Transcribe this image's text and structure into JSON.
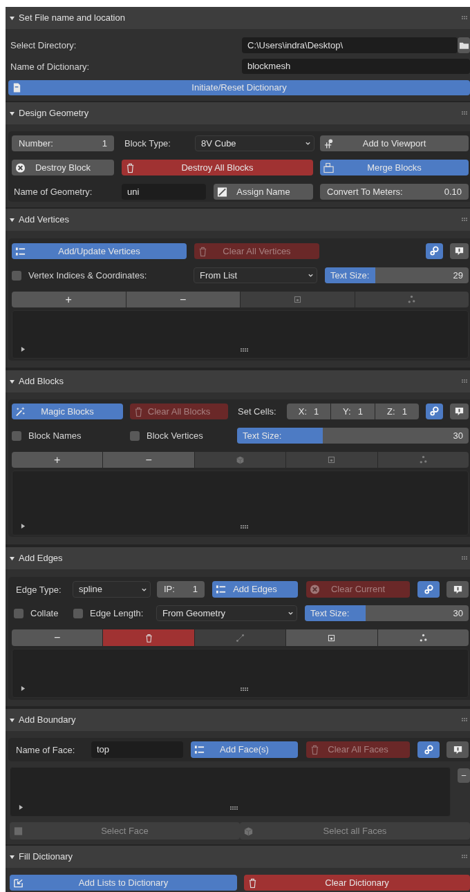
{
  "panels": [
    {
      "title": "Set File name and location",
      "expanded": true,
      "rows": [
        {
          "controls": [
            {
              "kind": "label",
              "text": "Select Directory:"
            },
            {
              "kind": "field",
              "value": "C:\\Users\\indra\\Desktop\\"
            },
            {
              "kind": "icon_button",
              "color": "#575757"
            }
          ]
        },
        {
          "controls": [
            {
              "kind": "label",
              "text": "Name of Dictionary:"
            },
            {
              "kind": "field",
              "value": "blockmesh"
            }
          ]
        },
        {
          "controls": [
            {
              "kind": "button",
              "label": "Initiate/Reset Dictionary",
              "color": "#4d7bc4",
              "disabled": false
            }
          ]
        }
      ]
    },
    {
      "title": "Design Geometry",
      "expanded": true,
      "rows": [
        {
          "controls": [
            {
              "kind": "number",
              "label": "Number:",
              "value": "1"
            },
            {
              "kind": "label",
              "text": "Block Type:"
            },
            {
              "kind": "dropdown",
              "value": "8V Cube"
            },
            {
              "kind": "button",
              "label": "Add to Viewport",
              "color": "#575757",
              "disabled": false
            }
          ]
        },
        {
          "controls": [
            {
              "kind": "button",
              "label": "Destroy Block",
              "color": "#575757",
              "disabled": false
            },
            {
              "kind": "button",
              "label": "Destroy All Blocks",
              "color": "#a03232",
              "disabled": false
            },
            {
              "kind": "button",
              "label": "Merge Blocks",
              "color": "#4d7bc4",
              "disabled": false
            }
          ]
        },
        {
          "controls": [
            {
              "kind": "label",
              "text": "Name of Geometry:"
            },
            {
              "kind": "field",
              "value": "uni"
            },
            {
              "kind": "button",
              "label": "Assign Name",
              "color": "#575757",
              "disabled": false
            },
            {
              "kind": "number",
              "label": "Convert To Meters:",
              "value": "0.10"
            }
          ]
        }
      ]
    },
    {
      "title": "Add Vertices",
      "expanded": true,
      "rows": [
        {
          "controls": [
            {
              "kind": "button",
              "label": "Add/Update Vertices",
              "color": "#4d7bc4",
              "disabled": false
            },
            {
              "kind": "button",
              "label": "Clear All Vertices",
              "color": "#6a2828",
              "disabled": true
            },
            {
              "kind": "icon_button",
              "color": "#4d7bc4"
            },
            {
              "kind": "icon_button",
              "color": "#575757"
            }
          ]
        },
        {
          "controls": [
            {
              "kind": "checkbox",
              "label": "Vertex Indices & Coordinates:",
              "checked": false
            },
            {
              "kind": "dropdown",
              "value": "From List"
            },
            {
              "kind": "slider",
              "label": "Text Size:",
              "value": "29",
              "level": 0.35
            }
          ]
        },
        {
          "controls": [
            {
              "kind": "toolbar",
              "segments": [
                {
                  "label": "+",
                  "color": "#575757",
                  "disabled": false
                },
                {
                  "label": "−",
                  "color": "#575757",
                  "disabled": false
                },
                {
                  "color": "#3e3e3e",
                  "disabled": true
                },
                {
                  "color": "#3e3e3e",
                  "disabled": true
                }
              ]
            }
          ]
        },
        {
          "controls": [
            {
              "kind": "list"
            }
          ]
        }
      ]
    },
    {
      "title": "Add Blocks",
      "expanded": true,
      "rows": [
        {
          "controls": [
            {
              "kind": "button",
              "label": "Magic Blocks",
              "color": "#4d7bc4",
              "disabled": false
            },
            {
              "kind": "button",
              "label": "Clear All Blocks",
              "color": "#6a2828",
              "disabled": true
            },
            {
              "kind": "label",
              "text": "Set Cells:"
            },
            {
              "kind": "number_group",
              "items": [
                {
                  "label": "X:",
                  "value": "1"
                },
                {
                  "label": "Y:",
                  "value": "1"
                },
                {
                  "label": "Z:",
                  "value": "1"
                }
              ]
            },
            {
              "kind": "icon_button",
              "color": "#4d7bc4"
            },
            {
              "kind": "icon_button",
              "color": "#575757"
            }
          ]
        },
        {
          "controls": [
            {
              "kind": "checkbox",
              "label": "Block Names",
              "checked": false
            },
            {
              "kind": "checkbox",
              "label": "Block Vertices",
              "checked": false
            },
            {
              "kind": "slider",
              "label": "Text Size:",
              "value": "30",
              "level": 0.37
            }
          ]
        },
        {
          "controls": [
            {
              "kind": "toolbar",
              "segments": [
                {
                  "label": "+",
                  "color": "#575757",
                  "disabled": false
                },
                {
                  "label": "−",
                  "color": "#575757",
                  "disabled": false
                },
                {
                  "color": "#3e3e3e",
                  "disabled": true
                },
                {
                  "color": "#3e3e3e",
                  "disabled": true
                },
                {
                  "color": "#3e3e3e",
                  "disabled": true
                }
              ]
            }
          ]
        },
        {
          "controls": [
            {
              "kind": "list"
            }
          ]
        }
      ]
    },
    {
      "title": "Add Edges",
      "expanded": true,
      "rows": [
        {
          "controls": [
            {
              "kind": "label",
              "text": "Edge Type:"
            },
            {
              "kind": "dropdown",
              "value": "spline"
            },
            {
              "kind": "number",
              "label": "IP:",
              "value": "1"
            },
            {
              "kind": "button",
              "label": "Add Edges",
              "color": "#4d7bc4",
              "disabled": false
            },
            {
              "kind": "button",
              "label": "Clear Current",
              "color": "#6a2828",
              "disabled": true
            },
            {
              "kind": "icon_button",
              "color": "#4d7bc4"
            },
            {
              "kind": "icon_button",
              "color": "#575757"
            }
          ]
        },
        {
          "controls": [
            {
              "kind": "checkbox",
              "label": "Collate",
              "checked": false
            },
            {
              "kind": "checkbox",
              "label": "Edge Length:",
              "checked": false
            },
            {
              "kind": "dropdown",
              "value": "From Geometry"
            },
            {
              "kind": "slider",
              "label": "Text Size:",
              "value": "30",
              "level": 0.37
            }
          ]
        },
        {
          "controls": [
            {
              "kind": "toolbar",
              "segments": [
                {
                  "label": "−",
                  "color": "#575757",
                  "disabled": false
                },
                {
                  "color": "#a03232",
                  "disabled": false
                },
                {
                  "color": "#3e3e3e",
                  "disabled": true
                },
                {
                  "color": "#575757",
                  "disabled": false
                },
                {
                  "color": "#575757",
                  "disabled": false
                }
              ]
            }
          ]
        },
        {
          "controls": [
            {
              "kind": "list"
            }
          ]
        }
      ]
    },
    {
      "title": "Add Boundary",
      "expanded": true,
      "rows": [
        {
          "controls": [
            {
              "kind": "label",
              "text": "Name of Face:"
            },
            {
              "kind": "field",
              "value": "top"
            },
            {
              "kind": "button",
              "label": "Add Face(s)",
              "color": "#4d7bc4",
              "disabled": false
            },
            {
              "kind": "button",
              "label": "Clear All Faces",
              "color": "#6a2828",
              "disabled": true
            },
            {
              "kind": "icon_button",
              "color": "#4d7bc4"
            },
            {
              "kind": "icon_button",
              "color": "#575757"
            }
          ]
        },
        {
          "controls": [
            {
              "kind": "list"
            },
            {
              "kind": "button",
              "label": "−",
              "color": "#575757",
              "disabled": false
            }
          ]
        },
        {
          "controls": [
            {
              "kind": "button",
              "label": "Select Face",
              "color": "#3e3e3e",
              "disabled": true
            },
            {
              "kind": "button",
              "label": "Select all Faces",
              "color": "#3e3e3e",
              "disabled": true
            }
          ]
        }
      ]
    },
    {
      "title": "Fill Dictionary",
      "expanded": true,
      "rows": [
        {
          "controls": [
            {
              "kind": "button",
              "label": "Add Lists to Dictionary",
              "color": "#4d7bc4",
              "disabled": false
            },
            {
              "kind": "button",
              "label": "Clear Dictionary",
              "color": "#a03232",
              "disabled": false
            }
          ]
        }
      ]
    }
  ]
}
